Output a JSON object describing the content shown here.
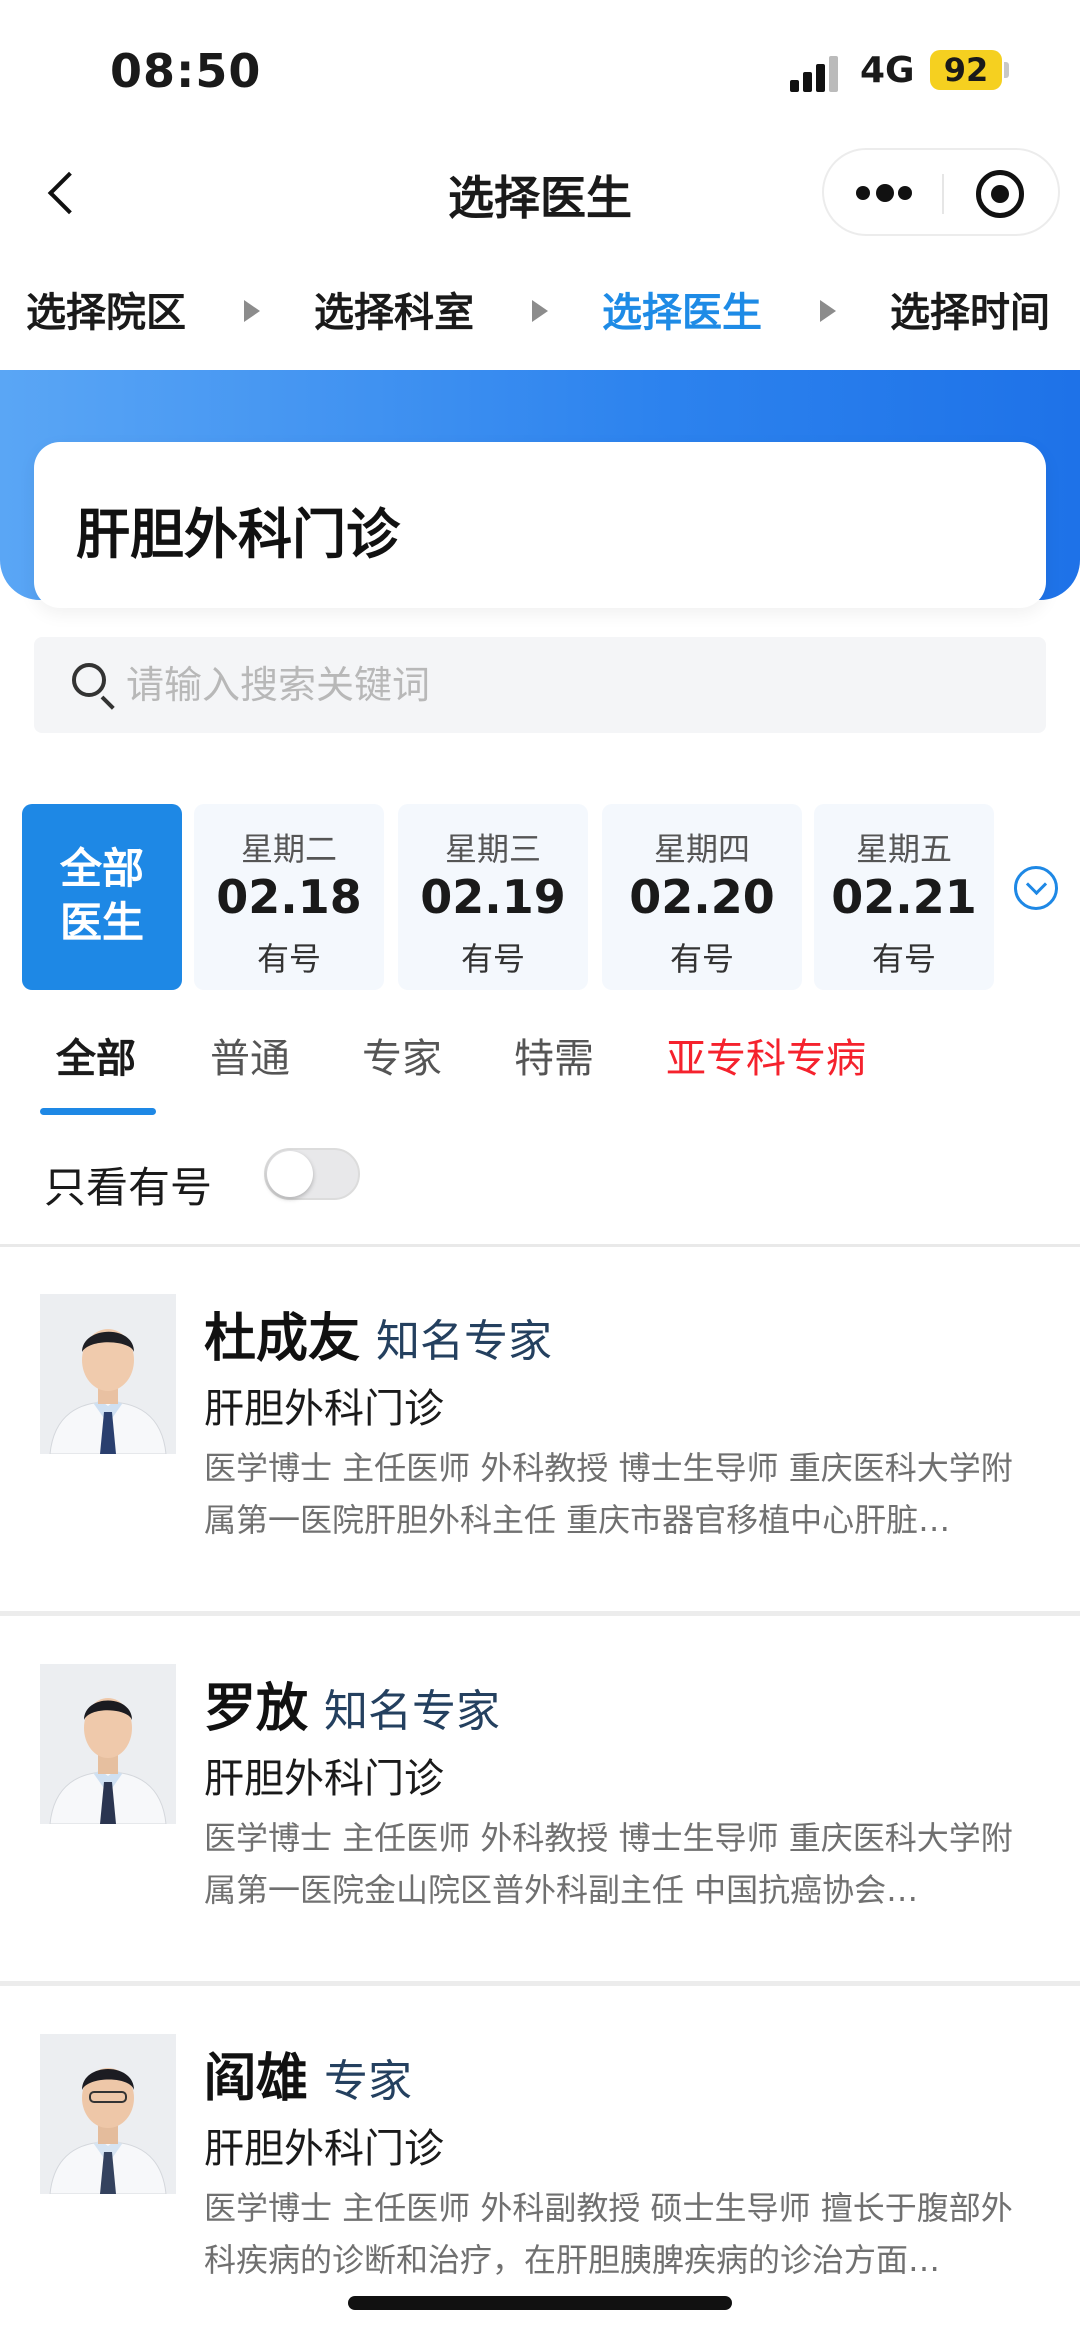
{
  "status_bar": {
    "time": "08:50",
    "network": "4G",
    "battery": "92"
  },
  "nav": {
    "title": "选择医生"
  },
  "steps": [
    "选择院区",
    "选择科室",
    "选择医生",
    "选择时间"
  ],
  "department": {
    "name": "肝胆外科门诊"
  },
  "search": {
    "placeholder": "请输入搜索关键词"
  },
  "date_selector": {
    "all_label_line1": "全部",
    "all_label_line2": "医生",
    "days": [
      {
        "weekday": "星期二",
        "date": "02.18",
        "status": "有号"
      },
      {
        "weekday": "星期三",
        "date": "02.19",
        "status": "有号"
      },
      {
        "weekday": "星期四",
        "date": "02.20",
        "status": "有号"
      },
      {
        "weekday": "星期五",
        "date": "02.21",
        "status": "有号"
      }
    ]
  },
  "tabs": [
    "全部",
    "普通",
    "专家",
    "特需",
    "亚专科专病"
  ],
  "filter": {
    "label": "只看有号",
    "enabled": false
  },
  "doctors": [
    {
      "name": "杜成友",
      "title": "知名专家",
      "dept": "肝胆外科门诊",
      "desc": "医学博士 主任医师 外科教授 博士生导师 重庆医科大学附属第一医院肝胆外科主任 重庆市器官移植中心肝脏…"
    },
    {
      "name": "罗放",
      "title": "知名专家",
      "dept": "肝胆外科门诊",
      "desc": "医学博士 主任医师 外科教授 博士生导师 重庆医科大学附属第一医院金山院区普外科副主任 中国抗癌协会…"
    },
    {
      "name": "阎雄",
      "title": "专家",
      "dept": "肝胆外科门诊",
      "desc": "医学博士 主任医师 外科副教授 硕士生导师 擅长于腹部外科疾病的诊断和治疗，在肝胆胰脾疾病的诊治方面…"
    }
  ],
  "colors": {
    "accent": "#1e88e5",
    "red_tab": "#f5222d",
    "title_blue": "#24405f"
  }
}
